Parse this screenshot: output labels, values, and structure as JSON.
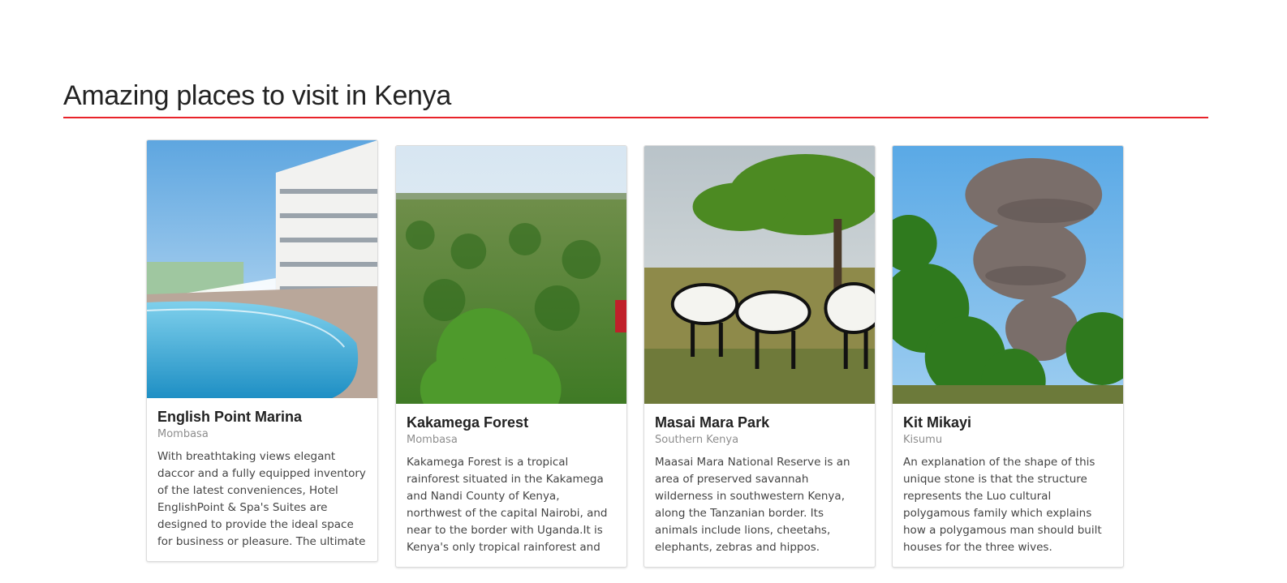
{
  "section": {
    "heading": "Amazing places to visit in Kenya",
    "accent_color": "#e8232a"
  },
  "cards": [
    {
      "title": "English Point Marina",
      "subtitle": "Mombasa",
      "text": "With breathtaking views elegant daccor and a fully equipped inventory of the latest conveniences, Hotel EnglishPoint & Spa's Suites are designed to provide the ideal space for business or pleasure. The ultimate serene accommodation.",
      "image": "hotel-pool-photo"
    },
    {
      "title": "Kakamega Forest",
      "subtitle": "Mombasa",
      "text": "Kakamega Forest is a tropical rainforest situated in the Kakamega and Nandi County of Kenya, northwest of the capital Nairobi, and near to the border with Uganda.It is Kenya's only tropical rainforest and the best place to chill",
      "image": "forest-canopy-photo"
    },
    {
      "title": "Masai Mara Park",
      "subtitle": "Southern Kenya",
      "text": "Maasai Mara National Reserve is an area of preserved savannah wilderness in southwestern Kenya, along the Tanzanian border. Its animals include lions, cheetahs, elephants, zebras and hippos.",
      "image": "zebras-savannah-photo"
    },
    {
      "title": "Kit Mikayi",
      "subtitle": "Kisumu",
      "text": "An explanation of the shape of this unique stone is that the structure represents the Luo cultural polygamous family which explains how a polygamous man should built houses for the three wives.",
      "image": "rock-formation-photo"
    }
  ]
}
